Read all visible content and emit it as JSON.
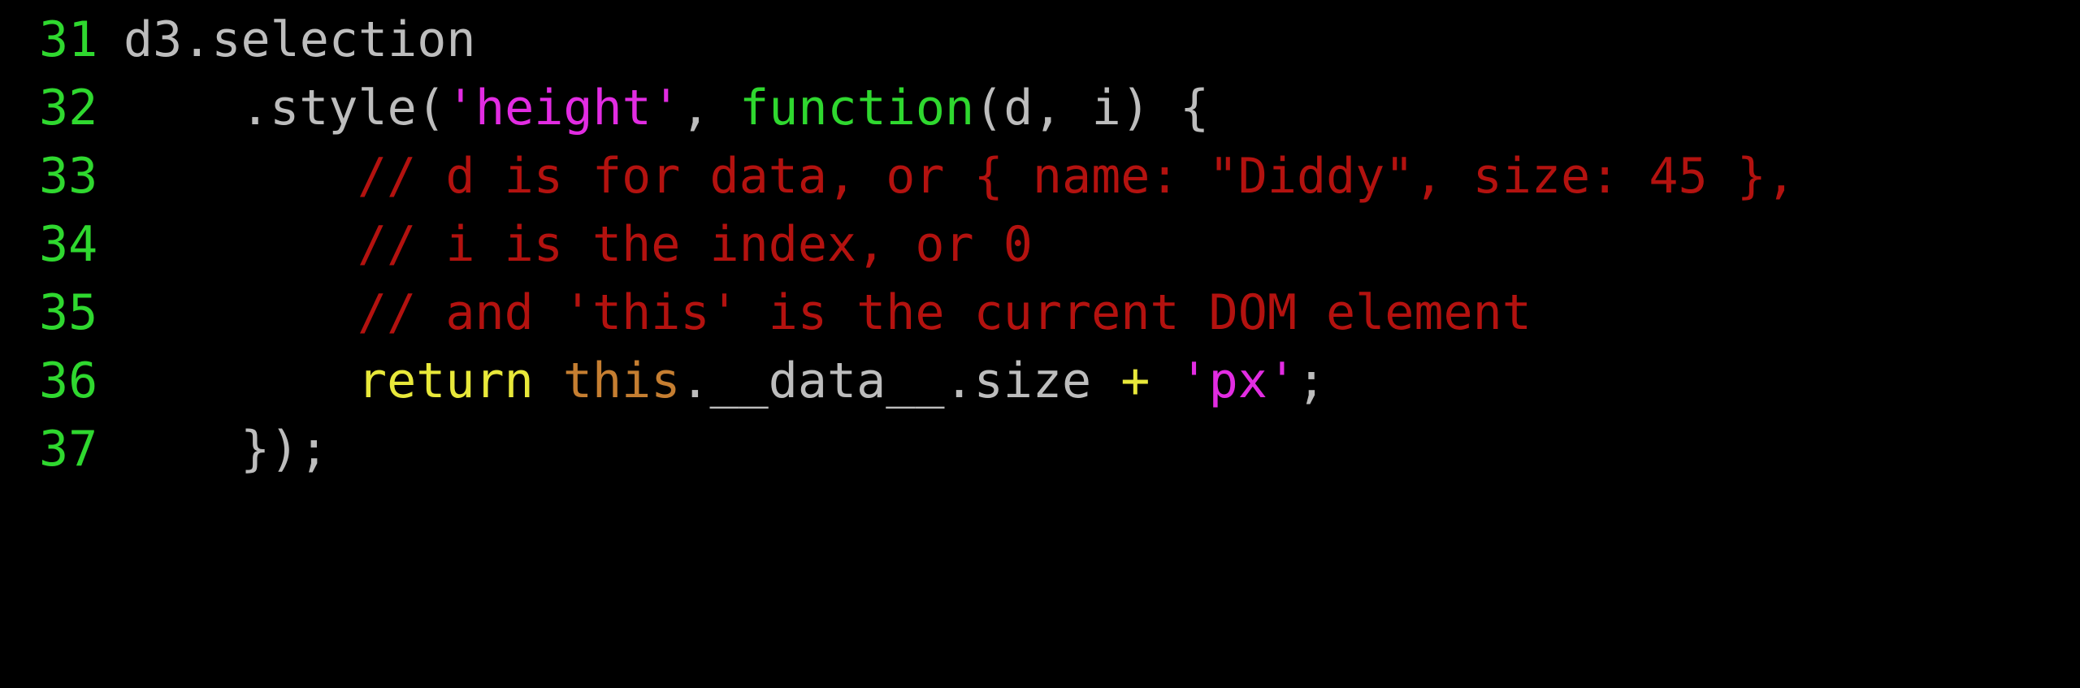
{
  "editor": {
    "colors": {
      "background": "#000000",
      "line_number": "#2fd82f",
      "plain": "#bdbdbd",
      "string": "#e22ce2",
      "keyword": "#2fd82f",
      "comment": "#b3120f",
      "return_keyword": "#e8e83a",
      "this_keyword": "#c57e31",
      "operator": "#e8e83a"
    },
    "lines": [
      {
        "number": "31",
        "tokens": [
          "d3.selection"
        ]
      },
      {
        "number": "32",
        "tokens": [
          ".style(",
          "'height'",
          ", ",
          "function",
          "(d, i) {"
        ]
      },
      {
        "number": "33",
        "tokens": [
          "// d is for data, or { name: \"Diddy\", size: 45 },"
        ]
      },
      {
        "number": "34",
        "tokens": [
          "// i is the index, or 0"
        ]
      },
      {
        "number": "35",
        "tokens": [
          "// and 'this' is the current DOM element"
        ]
      },
      {
        "number": "36",
        "tokens": [
          "return",
          " ",
          "this",
          ".__data__.size ",
          "+",
          " ",
          "'px'",
          ";"
        ]
      },
      {
        "number": "37",
        "tokens": [
          "});"
        ]
      }
    ]
  }
}
